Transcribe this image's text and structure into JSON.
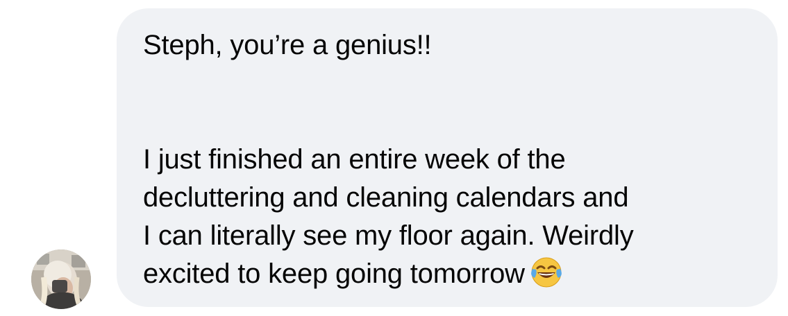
{
  "message": {
    "greeting": "Steph, you’re a genius!!",
    "body_lines": [
      "I just finished an entire week of the",
      "decluttering and cleaning calendars and",
      "I can literally see my floor again. Weirdly",
      "excited to keep going tomorrow"
    ],
    "emoji": "face-with-tears-of-joy"
  },
  "colors": {
    "bubble_bg": "#f0f2f5",
    "text": "#050505",
    "emoji_face": "#f6c642",
    "emoji_tears": "#5aa9e6"
  }
}
